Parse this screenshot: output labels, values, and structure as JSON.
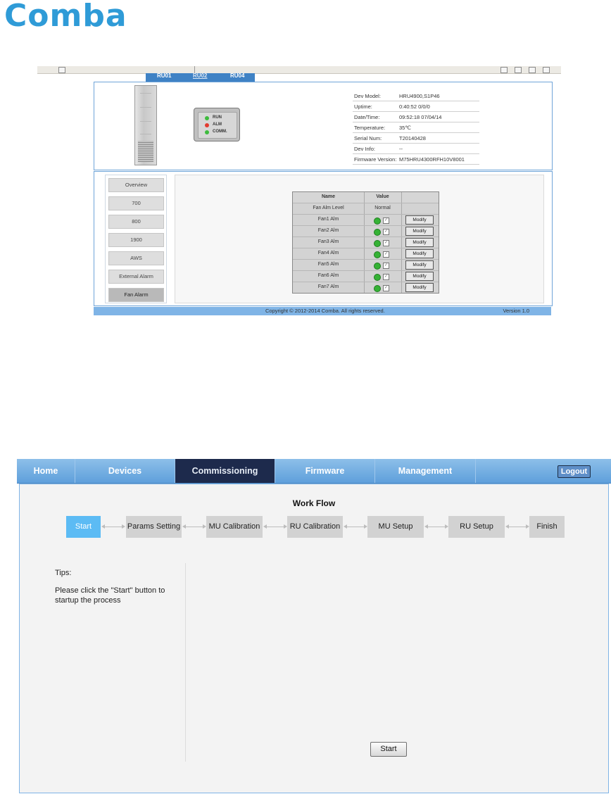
{
  "logo": {
    "text": "Comba",
    "color": "#2f9bd7"
  },
  "screenshot1": {
    "ru_tabs": [
      {
        "label": "RU01",
        "selected": false
      },
      {
        "label": "RU02",
        "selected": true
      },
      {
        "label": "RU04",
        "selected": false
      }
    ],
    "leds": [
      {
        "label": "RUN",
        "color": "#3dbb3d"
      },
      {
        "label": "ALM",
        "color": "#e23b30"
      },
      {
        "label": "COMM.",
        "color": "#3dbb3d"
      }
    ],
    "device_info": [
      {
        "key": "Dev Model:",
        "value": "HRU4900,S1P46"
      },
      {
        "key": "Uptime:",
        "value": "0:40:52 0/0/0"
      },
      {
        "key": "Date/Time:",
        "value": "09:52:18 07/04/14"
      },
      {
        "key": "Temperature:",
        "value": "35℃"
      },
      {
        "key": "Serial Num:",
        "value": "T20140428"
      },
      {
        "key": "Dev Info:",
        "value": "--"
      },
      {
        "key": "Firmware Version:",
        "value": "M75HRU4300RFH10V8001"
      }
    ],
    "side_nav": [
      {
        "label": "Overview",
        "selected": false
      },
      {
        "label": "700",
        "selected": false
      },
      {
        "label": "800",
        "selected": false
      },
      {
        "label": "1900",
        "selected": false
      },
      {
        "label": "AWS",
        "selected": false
      },
      {
        "label": "External Alarm",
        "selected": false
      },
      {
        "label": "Fan Alarm",
        "selected": true
      }
    ],
    "fan_table": {
      "headers": [
        "Name",
        "Value",
        ""
      ],
      "level_row": {
        "name": "Fan Alm Level",
        "value": "Normal"
      },
      "rows": [
        {
          "name": "Fan1 Alm",
          "button": "Modify"
        },
        {
          "name": "Fan2 Alm",
          "button": "Modify"
        },
        {
          "name": "Fan3 Alm",
          "button": "Modify"
        },
        {
          "name": "Fan4 Alm",
          "button": "Modify"
        },
        {
          "name": "Fan5 Alm",
          "button": "Modify"
        },
        {
          "name": "Fan6 Alm",
          "button": "Modify"
        },
        {
          "name": "Fan7 Alm",
          "button": "Modify"
        }
      ]
    },
    "footer": {
      "copyright": "Copyright © 2012-2014 Comba. All rights reserved.",
      "version": "Version 1.0"
    }
  },
  "screenshot2": {
    "nav": [
      {
        "label": "Home",
        "active": false
      },
      {
        "label": "Devices",
        "active": false
      },
      {
        "label": "Commissioning",
        "active": true
      },
      {
        "label": "Firmware",
        "active": false
      },
      {
        "label": "Management",
        "active": false
      }
    ],
    "logout_label": "Logout",
    "workflow_title": "Work Flow",
    "steps": [
      {
        "label": "Start",
        "current": true
      },
      {
        "label": "Params Setting",
        "current": false
      },
      {
        "label": "MU Calibration",
        "current": false
      },
      {
        "label": "RU Calibration",
        "current": false
      },
      {
        "label": "MU Setup",
        "current": false
      },
      {
        "label": "RU Setup",
        "current": false
      },
      {
        "label": "Finish",
        "current": false
      }
    ],
    "tips_title": "Tips:",
    "tips_text": "Please click the \"Start\" button to startup the process",
    "start_button": "Start"
  }
}
